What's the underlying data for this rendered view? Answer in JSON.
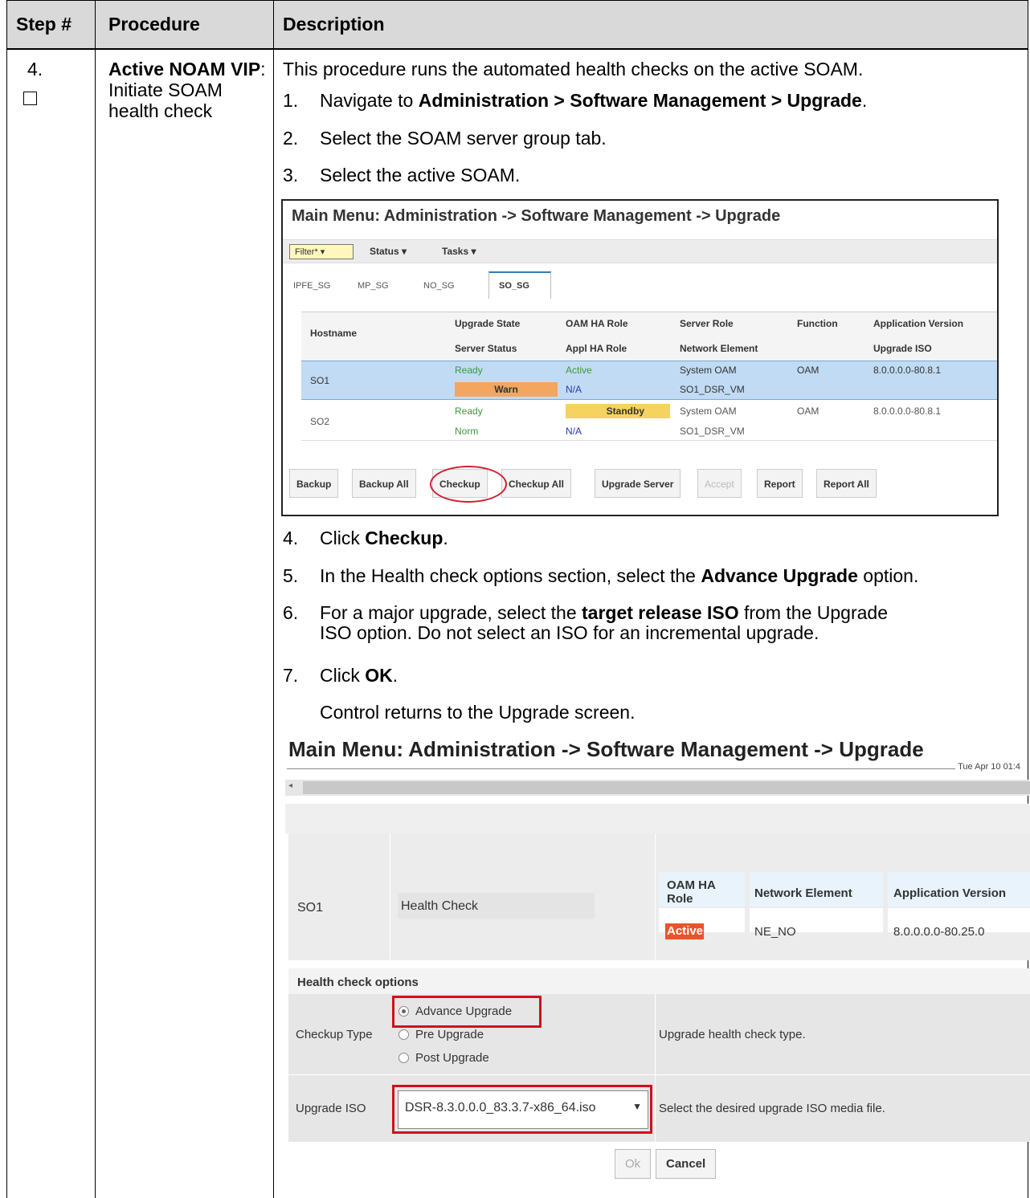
{
  "header": {
    "step": "Step #",
    "procedure": "Procedure",
    "description": "Description"
  },
  "step": {
    "number": "4.",
    "procedure_bold": "Active NOAM VIP",
    "procedure_rest": ": Initiate SOAM health check",
    "intro": "This procedure runs the automated health checks on the active SOAM."
  },
  "steps": {
    "s1_num": "1.",
    "s1_pre": "Navigate to ",
    "s1_bold": "Administration > Software Management > Upgrade",
    "s1_post": ".",
    "s2_num": "2.",
    "s2_text": "Select the SOAM server group tab.",
    "s3_num": "3.",
    "s3_text": "Select the active SOAM.",
    "s4_num": "4.",
    "s4_pre": "Click ",
    "s4_bold": "Checkup",
    "s4_post": ".",
    "s5_num": "5.",
    "s5_pre": "In the Health check options section, select the ",
    "s5_bold": "Advance Upgrade",
    "s5_post": " option.",
    "s6_num": "6.",
    "s6_pre": "For a major upgrade, select the ",
    "s6_bold": "target release ISO",
    "s6_post": " from the Upgrade",
    "s6_line2": "ISO option.  Do not select an ISO for an incremental upgrade.",
    "s7_num": "7.",
    "s7_pre": "Click ",
    "s7_bold": "OK",
    "s7_post": ".",
    "after": "Control returns to the Upgrade screen."
  },
  "screenshot1": {
    "title": "Main Menu: Administration -> Software Management -> Upgrade",
    "filter": "Filter* ▾",
    "status": "Status ▾",
    "tasks": "Tasks ▾",
    "tabs": [
      "IPFE_SG",
      "MP_SG",
      "NO_SG",
      "SO_SG"
    ],
    "col_hostname": "Hostname",
    "col_upgrade_state": "Upgrade State",
    "col_server_status": "Server Status",
    "col_oam_ha": "OAM HA Role",
    "col_appl_ha": "Appl HA Role",
    "col_server_role": "Server Role",
    "col_network_element": "Network Element",
    "col_function": "Function",
    "col_app_version": "Application Version",
    "col_upgrade_iso": "Upgrade ISO",
    "rows": [
      {
        "host": "SO1",
        "state": "Ready",
        "status": "Warn",
        "oam": "Active",
        "appl": "N/A",
        "role": "System OAM",
        "ne": "SO1_DSR_VM",
        "func": "OAM",
        "ver": "8.0.0.0.0-80.8.1"
      },
      {
        "host": "SO2",
        "state": "Ready",
        "status": "Norm",
        "oam": "Standby",
        "appl": "N/A",
        "role": "System OAM",
        "ne": "SO1_DSR_VM",
        "func": "OAM",
        "ver": "8.0.0.0.0-80.8.1"
      }
    ],
    "buttons": [
      "Backup",
      "Backup All",
      "Checkup",
      "Checkup All",
      "Upgrade Server",
      "Accept",
      "Report",
      "Report All"
    ]
  },
  "screenshot2": {
    "title": "Main Menu: Administration -> Software Management -> Upgrade",
    "date": "Tue Apr 10 01:4",
    "host": "SO1",
    "action": "Health Check",
    "col_oam": "OAM HA Role",
    "col_ne": "Network Element",
    "col_ver": "Application Version",
    "val_oam": "Active",
    "val_ne": "NE_NO",
    "val_ver": "8.0.0.0.0-80.25.0",
    "options_label": "Health check options",
    "checkup_label": "Checkup Type",
    "opt_advance": "Advance Upgrade",
    "opt_pre": "Pre Upgrade",
    "opt_post": "Post Upgrade",
    "checkup_desc": "Upgrade health check type.",
    "iso_label": "Upgrade ISO",
    "iso_value": "DSR-8.3.0.0.0_83.3.7-x86_64.iso",
    "iso_desc": "Select the desired upgrade ISO media file.",
    "ok": "Ok",
    "cancel": "Cancel"
  },
  "colors": {
    "header_bg": "#d9d9d9",
    "selected_row": "#c0dbf3",
    "warn": "#f4a55e",
    "standby": "#f4d35e",
    "active_badge": "#e8552a",
    "highlight_red": "#d01020"
  }
}
